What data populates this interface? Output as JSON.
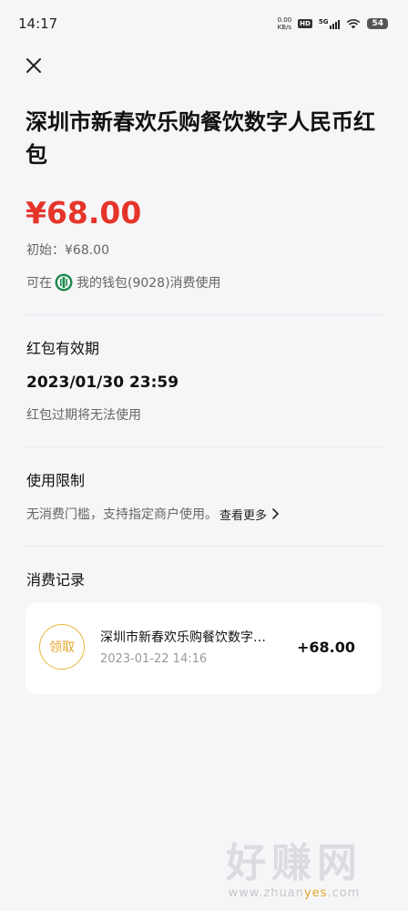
{
  "status_bar": {
    "time": "14:17",
    "net_speed_value": "0.00",
    "net_speed_unit": "KB/s",
    "hd": "HD",
    "signal": "5G",
    "battery": "54"
  },
  "page": {
    "title": "深圳市新春欢乐购餐饮数字人民币红包",
    "amount": "¥68.00",
    "initial": "初始：¥68.00",
    "usable_prefix": "可在",
    "usable_suffix": "我的钱包(9028)消费使用"
  },
  "validity": {
    "label": "红包有效期",
    "value": "2023/01/30 23:59",
    "note": "红包过期将无法使用"
  },
  "restriction": {
    "label": "使用限制",
    "text": "无消费门槛，支持指定商户使用。",
    "see_more": "查看更多"
  },
  "records": {
    "label": "消费记录",
    "items": [
      {
        "badge": "领取",
        "name": "深圳市新春欢乐购餐饮数字…",
        "date": "2023-01-22 14:16",
        "amount": "+68.00"
      }
    ]
  },
  "watermark": {
    "big": "好赚网",
    "small_pre": "www.zhuan",
    "small_accent": "yes",
    "small_post": ".com"
  },
  "colors": {
    "amount_red": "#e5352a",
    "badge_gold": "#e6b53d",
    "bank_green": "#1f8a4c"
  }
}
